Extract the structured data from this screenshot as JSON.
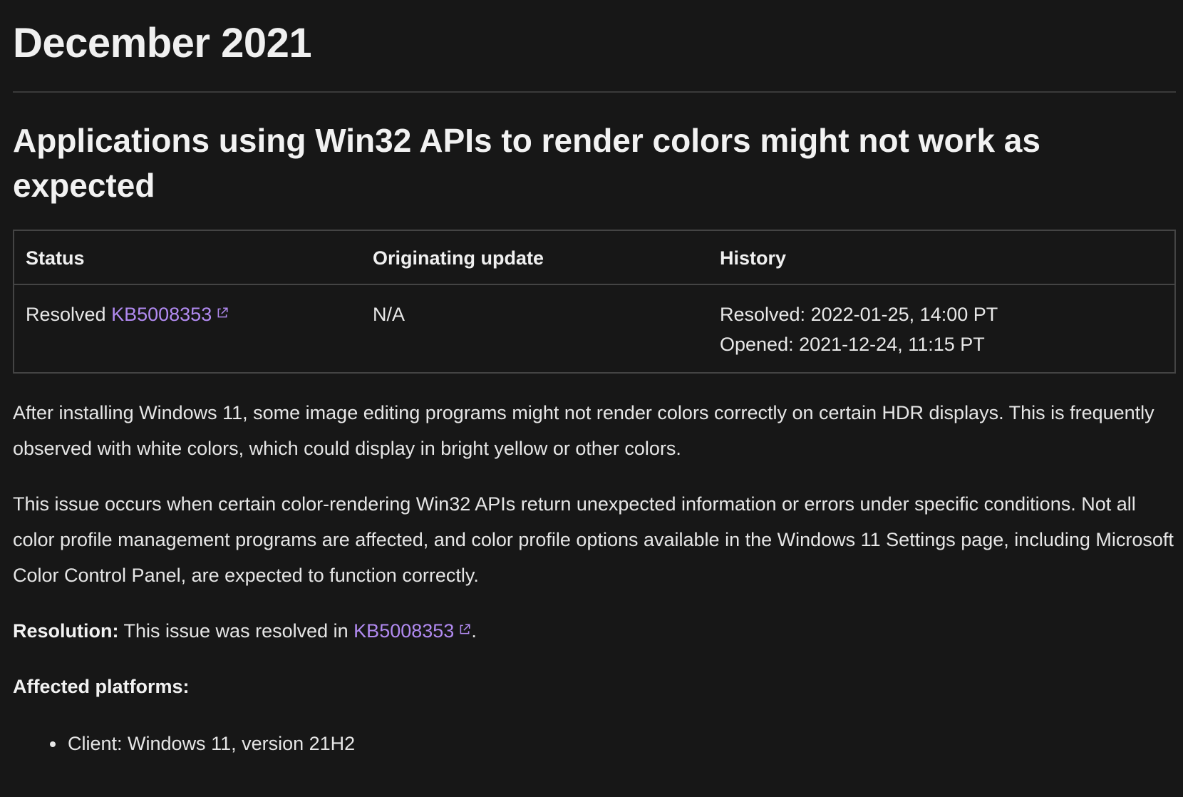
{
  "month_heading": "December 2021",
  "issue": {
    "title": "Applications using Win32 APIs to render colors might not work as expected",
    "table": {
      "headers": {
        "status": "Status",
        "originating_update": "Originating update",
        "history": "History"
      },
      "row": {
        "status_text": "Resolved",
        "status_link": "KB5008353",
        "originating_update": "N/A",
        "history_resolved": "Resolved: 2022-01-25, 14:00 PT",
        "history_opened": "Opened: 2021-12-24, 11:15 PT"
      }
    },
    "paragraph1": "After installing Windows 11, some image editing programs might not render colors correctly on certain HDR displays. This is frequently observed with white colors, which could display in bright yellow or other colors.",
    "paragraph2": "This issue occurs when certain color-rendering Win32 APIs return unexpected information or errors under specific conditions. Not all color profile management programs are affected, and color profile options available in the Windows 11 Settings page, including Microsoft Color Control Panel, are expected to function correctly.",
    "resolution": {
      "label": "Resolution:",
      "text": "This issue was resolved in",
      "link": "KB5008353",
      "suffix": "."
    },
    "affected_platforms": {
      "label": "Affected platforms:",
      "items": [
        "Client: Windows 11, version 21H2"
      ]
    }
  },
  "colors": {
    "background": "#171717",
    "text": "#e6e6e6",
    "link": "#b18af0",
    "border": "#444444"
  },
  "icons": {
    "external_link": "external-link-icon"
  }
}
